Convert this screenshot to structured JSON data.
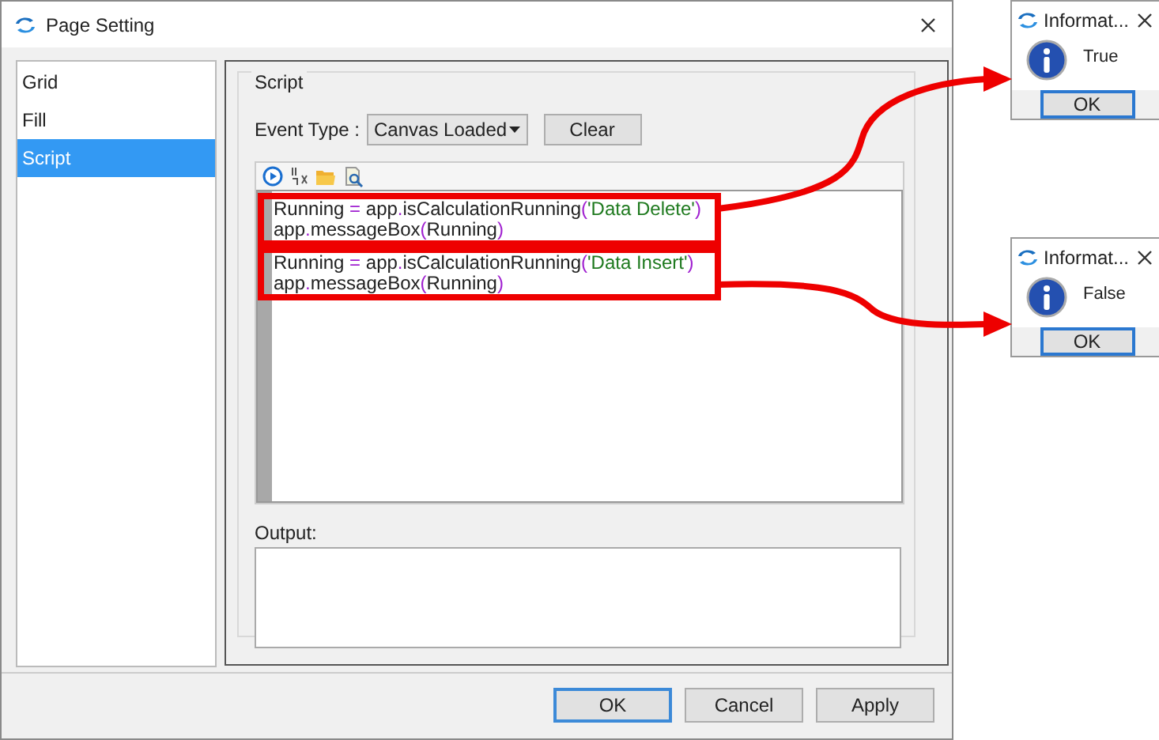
{
  "window": {
    "title": "Page Setting"
  },
  "sidebar": {
    "items": [
      {
        "label": "Grid",
        "selected": false
      },
      {
        "label": "Fill",
        "selected": false
      },
      {
        "label": "Script",
        "selected": true
      }
    ]
  },
  "script_group": {
    "title": "Script",
    "event_type": {
      "label": "Event Type :",
      "value": "Canvas Loaded"
    },
    "clear_button": "Clear",
    "code_blocks": [
      {
        "highlighted": true,
        "lines": [
          "Running = app.isCalculationRunning('Data Delete')",
          "app.messageBox(Running)"
        ]
      },
      {
        "highlighted": true,
        "lines": [
          "Running = app.isCalculationRunning('Data Insert')",
          "app.messageBox(Running)"
        ]
      }
    ],
    "output": {
      "label": "Output:"
    }
  },
  "buttons": [
    {
      "label": "OK",
      "default": true
    },
    {
      "label": "Cancel",
      "default": false
    },
    {
      "label": "Apply",
      "default": false
    }
  ],
  "dialogs": [
    {
      "title": "Informat...",
      "message": "True",
      "button": "OK"
    },
    {
      "title": "Informat...",
      "message": "False",
      "button": "OK"
    }
  ]
}
